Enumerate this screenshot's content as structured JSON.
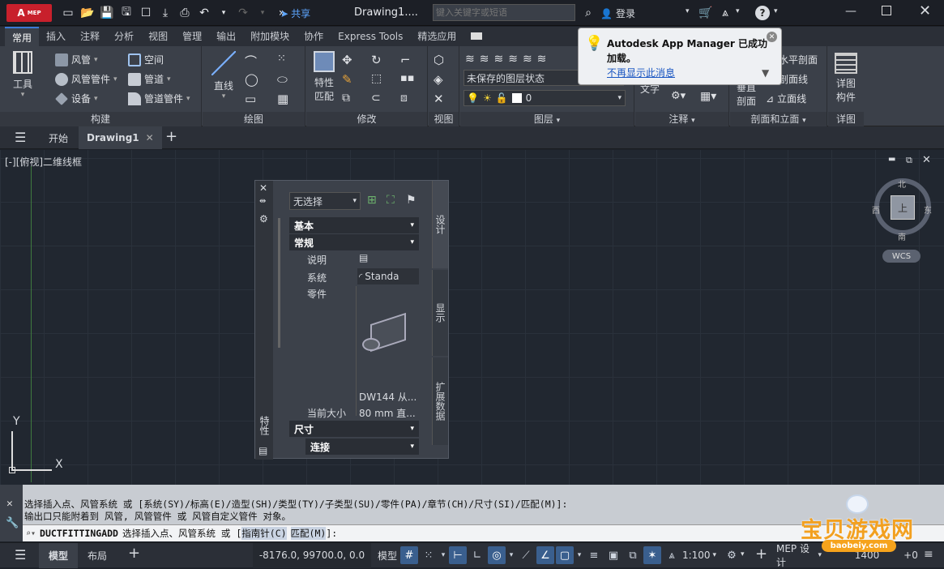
{
  "titlebar": {
    "app_badge": "A",
    "app_badge_sub": "MEP",
    "share_label": "共享",
    "doc_title": "Drawing1....",
    "search_placeholder": "键入关键字或短语",
    "login_label": "登录"
  },
  "ribbon_tabs": [
    "常用",
    "插入",
    "注释",
    "分析",
    "视图",
    "管理",
    "输出",
    "附加模块",
    "协作",
    "Express Tools",
    "精选应用"
  ],
  "ribbon": {
    "build": {
      "tools_label": "工具",
      "duct": "风管",
      "duct_fitting": "风管管件",
      "equipment": "设备",
      "space": "空间",
      "pipe": "管道",
      "pipe_fitting": "管道管件",
      "title": "构建"
    },
    "draw": {
      "line_label": "直线",
      "title": "绘图"
    },
    "modify": {
      "match_label": "特性\n匹配",
      "match_line1": "特性",
      "match_line2": "匹配",
      "title": "修改"
    },
    "view": {
      "title": "视图"
    },
    "layers": {
      "state": "未保存的图层状态",
      "layer": "0",
      "title": "图层"
    },
    "annotation": {
      "text_label": "文字",
      "title": "注释"
    },
    "section": {
      "vertical_line1": "垂直",
      "vertical_line2": "剖面",
      "horizontal": "水平剖面",
      "section_line": "剖面线",
      "elevation_line": "立面线",
      "title": "剖面和立面"
    },
    "detail": {
      "line1": "详图",
      "line2": "构件",
      "title": "详图"
    }
  },
  "notification": {
    "title": "Autodesk App Manager 已成功",
    "title2": "加载。",
    "link": "不再显示此消息"
  },
  "doc_tabs": {
    "start": "开始",
    "drawing": "Drawing1"
  },
  "viewport_label": "[-][俯视]二维线框",
  "properties": {
    "selection": "无选择",
    "section_basic": "基本",
    "section_general": "常规",
    "desc_label": "说明",
    "system_label": "系统",
    "system_value": "Standa",
    "part_label": "零件",
    "part_name": "DW144 从...",
    "size_label": "当前大小",
    "size_value": "80 mm 直...",
    "section_dims": "尺寸",
    "section_conn": "连接",
    "tab_design": "设计",
    "tab_display": "显示",
    "tab_ext": "扩展数据",
    "strip_title": "特性"
  },
  "navcube": {
    "north": "北",
    "south": "南",
    "east": "东",
    "west": "西",
    "face": "上",
    "wcs": "WCS"
  },
  "axis": {
    "y": "Y",
    "x": "X"
  },
  "command": {
    "history1": "选择插入点、风管系统 或 [系统(SY)/标高(E)/造型(SH)/类型(TY)/子类型(SU)/零件(PA)/章节(CH)/尺寸(SI)/匹配(M)]:",
    "history2": "输出口只能附着到 风管, 风管管件 或 风管自定义管件 对象。",
    "current_cmd": "DUCTFITTINGADD",
    "current_prompt": "选择插入点、风管系统 或 [",
    "opt1": "指南针(C)",
    "opt2": "匹配(M)",
    "end": "]:"
  },
  "statusbar": {
    "model_tab": "模型",
    "layout_tab": "布局",
    "coords": "-8176.0, 99700.0, 0.0",
    "model_btn": "模型",
    "scale": "1:100",
    "workspace": "MEP 设计",
    "elev": "1400",
    "offset": "+0"
  },
  "watermark": {
    "text": "宝贝游戏网",
    "url": "baobeiy.com"
  }
}
